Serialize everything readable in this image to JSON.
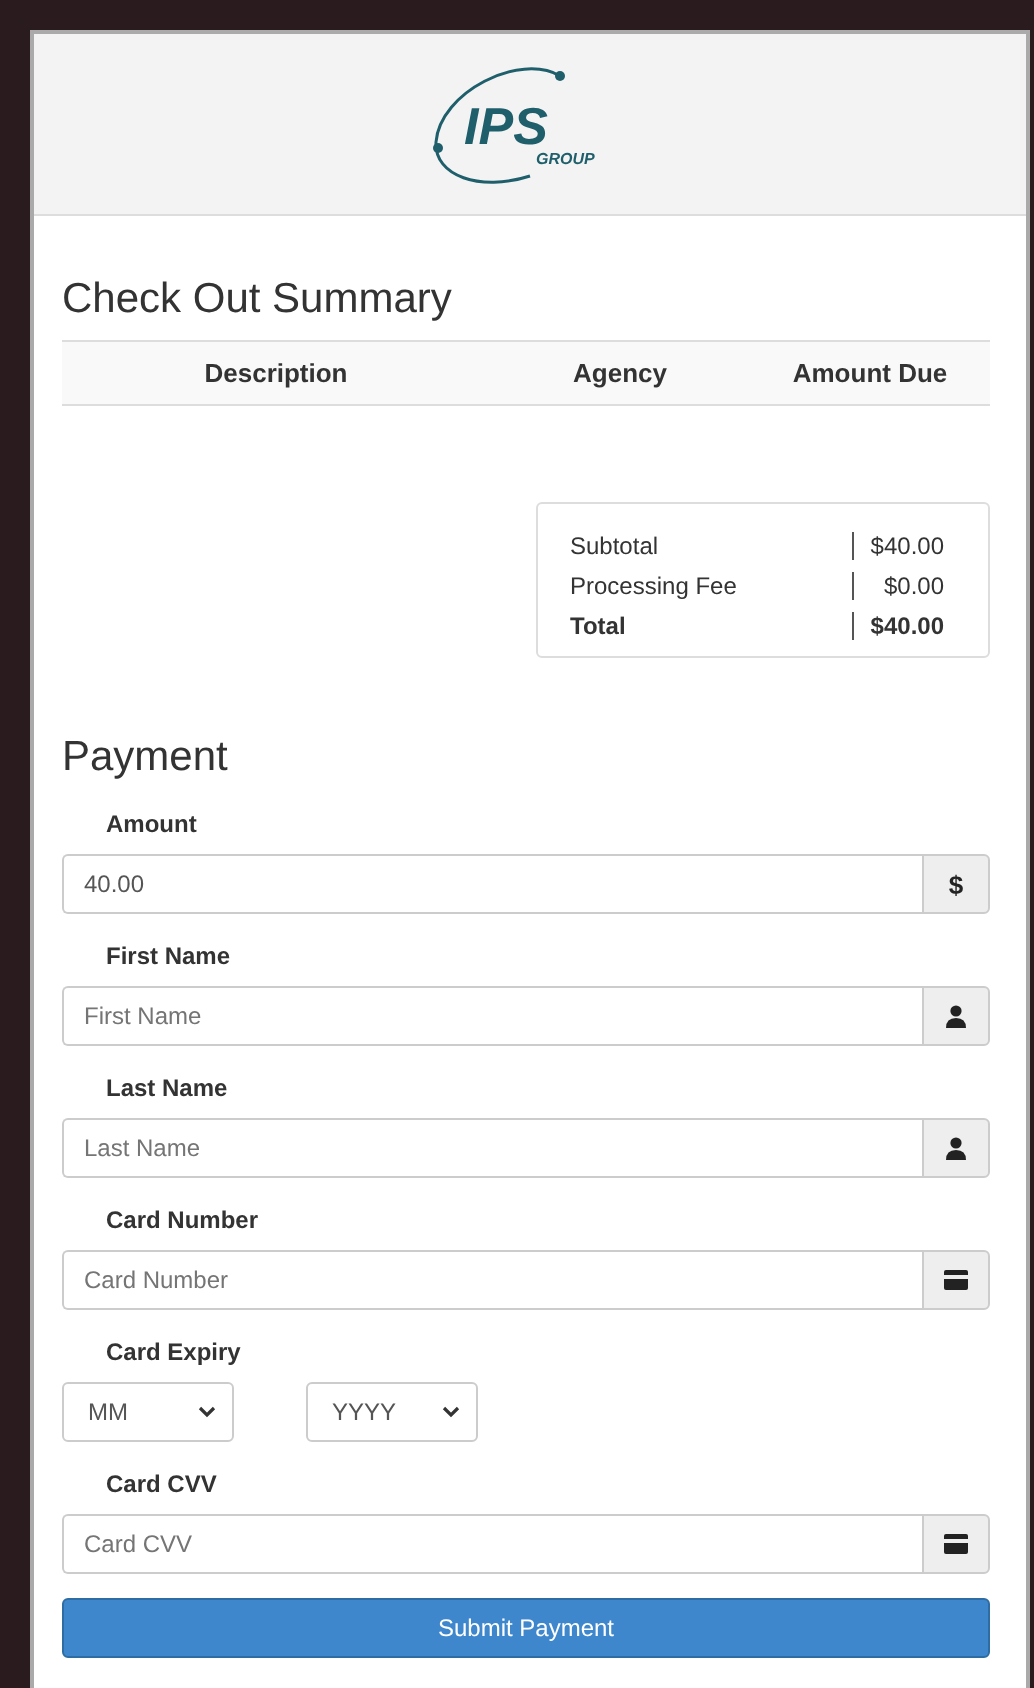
{
  "header": {
    "logo_text": "IPS",
    "logo_subtext": "GROUP"
  },
  "summary": {
    "title": "Check Out Summary",
    "columns": [
      "Description",
      "Agency",
      "Amount Due"
    ],
    "totals": [
      {
        "label": "Subtotal",
        "value": "$40.00",
        "bold": false
      },
      {
        "label": "Processing Fee",
        "value": "$0.00",
        "bold": false
      },
      {
        "label": "Total",
        "value": "$40.00",
        "bold": true
      }
    ]
  },
  "payment": {
    "title": "Payment",
    "fields": [
      {
        "label": "Amount",
        "value": "40.00",
        "kind": "currency",
        "addon": "$"
      },
      {
        "label": "First Name",
        "placeholder": "First Name",
        "kind": "person"
      },
      {
        "label": "Last Name",
        "placeholder": "Last Name",
        "kind": "person"
      },
      {
        "label": "Card Number",
        "placeholder": "Card Number",
        "kind": "card"
      }
    ],
    "expiry": {
      "label": "Card Expiry",
      "month": "MM",
      "year": "YYYY"
    },
    "cvv": {
      "label": "Card CVV",
      "placeholder": "Card CVV",
      "kind": "card"
    },
    "submit": "Submit Payment"
  }
}
